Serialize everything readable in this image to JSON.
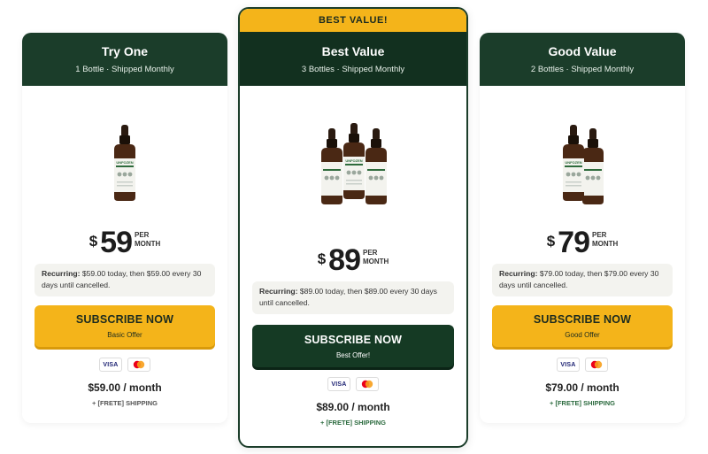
{
  "colors": {
    "dark_green": "#1b3d2a",
    "accent_yellow": "#f4b41a",
    "button_dark": "#153a24"
  },
  "cards": [
    {
      "title": "Try One",
      "subtitle": "1 Bottle · Shipped Monthly",
      "bottle_label": "UNFOZEN",
      "price": "59",
      "currency": "$",
      "per_line1": "PER",
      "per_line2": "MONTH",
      "recurring_label": "Recurring:",
      "recurring_text": "$59.00 today, then $59.00 every 30 days until cancelled.",
      "button_label": "SUBSCRIBE NOW",
      "button_sub": "Basic Offer",
      "payment_icons": [
        "visa-icon",
        "mastercard-icon"
      ],
      "visa_text": "VISA",
      "month_price": "$59.00 / month",
      "shipping_prefix": "+ [FRETE]",
      "shipping_label": "SHIPPING"
    },
    {
      "ribbon": "BEST VALUE!",
      "title": "Best Value",
      "subtitle": "3 Bottles · Shipped Monthly",
      "bottle_label": "UNFOZEN",
      "price": "89",
      "currency": "$",
      "per_line1": "PER",
      "per_line2": "MONTH",
      "recurring_label": "Recurring:",
      "recurring_text": "$89.00 today, then $89.00 every 30 days until cancelled.",
      "button_label": "SUBSCRIBE NOW",
      "button_sub": "Best Offer!",
      "payment_icons": [
        "visa-icon",
        "mastercard-icon"
      ],
      "visa_text": "VISA",
      "month_price": "$89.00 / month",
      "shipping_prefix": "+ [FRETE]",
      "shipping_label": "SHIPPING"
    },
    {
      "title": "Good Value",
      "subtitle": "2 Bottles · Shipped Monthly",
      "bottle_label": "UNFOZEN",
      "price": "79",
      "currency": "$",
      "per_line1": "PER",
      "per_line2": "MONTH",
      "recurring_label": "Recurring:",
      "recurring_text": "$79.00 today, then $79.00 every 30 days until cancelled.",
      "button_label": "SUBSCRIBE NOW",
      "button_sub": "Good Offer",
      "payment_icons": [
        "visa-icon",
        "mastercard-icon"
      ],
      "visa_text": "VISA",
      "month_price": "$79.00 / month",
      "shipping_prefix": "+ [FRETE]",
      "shipping_label": "SHIPPING"
    }
  ]
}
